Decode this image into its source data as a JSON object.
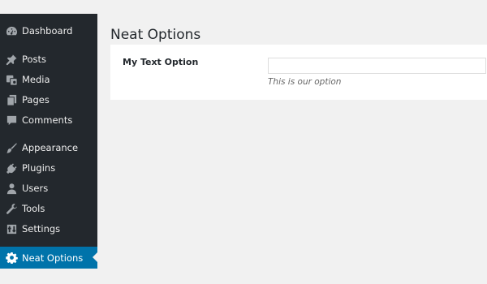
{
  "sidebar": {
    "items": [
      {
        "label": "Dashboard",
        "icon": "dashboard-icon"
      },
      {
        "label": "Posts",
        "icon": "pin-icon"
      },
      {
        "label": "Media",
        "icon": "media-icon"
      },
      {
        "label": "Pages",
        "icon": "pages-icon"
      },
      {
        "label": "Comments",
        "icon": "comment-icon"
      },
      {
        "label": "Appearance",
        "icon": "brush-icon"
      },
      {
        "label": "Plugins",
        "icon": "plug-icon"
      },
      {
        "label": "Users",
        "icon": "user-icon"
      },
      {
        "label": "Tools",
        "icon": "wrench-icon"
      },
      {
        "label": "Settings",
        "icon": "settings-icon"
      },
      {
        "label": "Neat Options",
        "icon": "gear-icon",
        "current": true
      }
    ]
  },
  "page": {
    "title": "Neat Options"
  },
  "form": {
    "field_label": "My Text Option",
    "field_value": "",
    "field_description": "This is our option"
  },
  "colors": {
    "sidebar_bg": "#23282d",
    "active_item_bg": "#0073aa",
    "page_bg": "#f1f1f1"
  }
}
